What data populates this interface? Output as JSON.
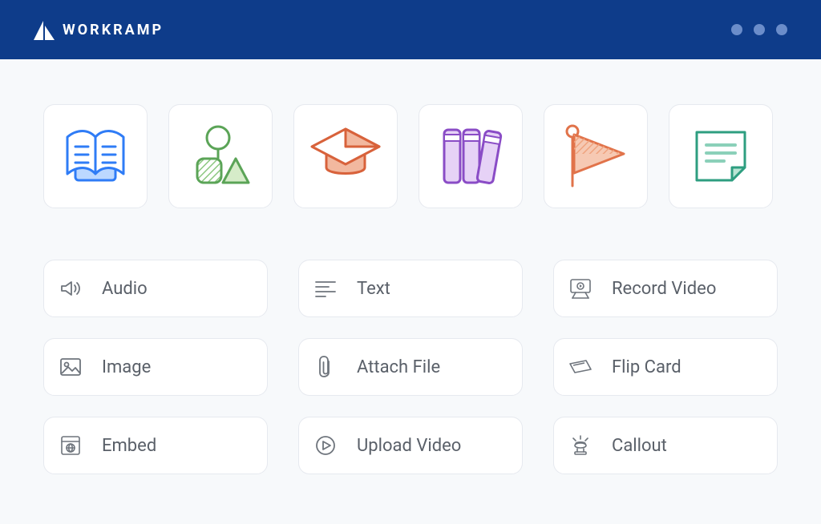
{
  "app": {
    "name": "WORKRAMP"
  },
  "colors": {
    "topbar_bg": "#0e3c8a",
    "page_bg": "#f7f9fb",
    "card_border": "#e6e9ef",
    "text_secondary": "#5a6069",
    "icon_muted": "#6e747c"
  },
  "content_type_tiles": [
    {
      "id": "book",
      "icon": "book-icon",
      "accent": "#2f7cf6"
    },
    {
      "id": "shapes",
      "icon": "shapes-icon",
      "accent": "#5ba457"
    },
    {
      "id": "cap",
      "icon": "grad-cap-icon",
      "accent": "#d8623b"
    },
    {
      "id": "library",
      "icon": "library-icon",
      "accent": "#8a4cc6"
    },
    {
      "id": "flag",
      "icon": "flag-icon",
      "accent": "#e1734a"
    },
    {
      "id": "note",
      "icon": "note-icon",
      "accent": "#2e9e80"
    }
  ],
  "content_blocks": [
    {
      "id": "audio",
      "label": "Audio",
      "icon": "audio-icon"
    },
    {
      "id": "text",
      "label": "Text",
      "icon": "text-icon"
    },
    {
      "id": "record_video",
      "label": "Record Video",
      "icon": "record-video-icon"
    },
    {
      "id": "image",
      "label": "Image",
      "icon": "image-icon"
    },
    {
      "id": "attach_file",
      "label": "Attach File",
      "icon": "attach-file-icon"
    },
    {
      "id": "flip_card",
      "label": "Flip Card",
      "icon": "flip-card-icon"
    },
    {
      "id": "embed",
      "label": "Embed",
      "icon": "embed-icon"
    },
    {
      "id": "upload_video",
      "label": "Upload Video",
      "icon": "upload-video-icon"
    },
    {
      "id": "callout",
      "label": "Callout",
      "icon": "callout-icon"
    }
  ]
}
